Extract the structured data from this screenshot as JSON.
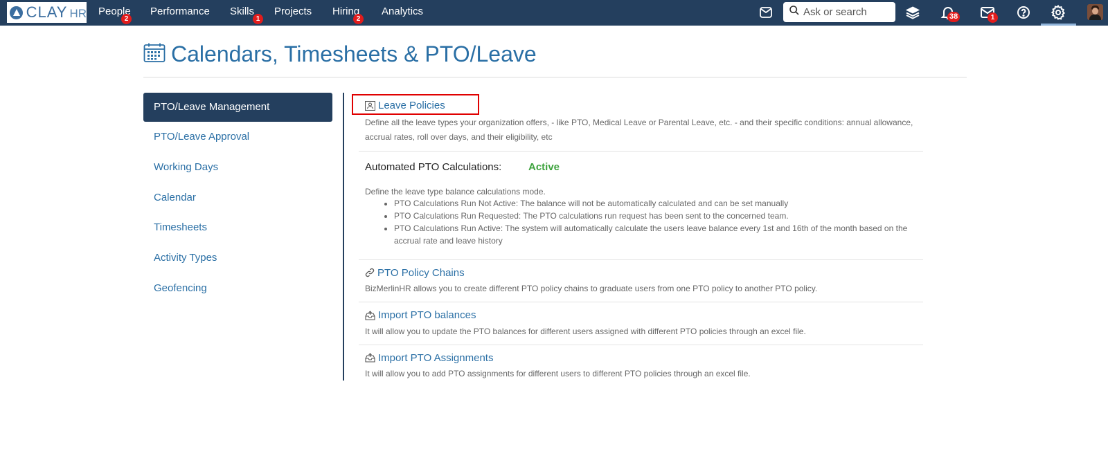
{
  "brand": {
    "logo_text": "CLAY",
    "logo_suffix": "HR"
  },
  "nav": {
    "items": [
      {
        "label": "People",
        "badge": "2"
      },
      {
        "label": "Performance",
        "badge": ""
      },
      {
        "label": "Skills",
        "badge": "1"
      },
      {
        "label": "Projects",
        "badge": ""
      },
      {
        "label": "Hiring",
        "badge": "2"
      },
      {
        "label": "Analytics",
        "badge": ""
      }
    ],
    "search_placeholder": "Ask or search",
    "notifications_badge": "38",
    "messages_badge": "1"
  },
  "page": {
    "title": "Calendars, Timesheets & PTO/Leave"
  },
  "sidebar": {
    "items": [
      {
        "label": "PTO/Leave Management",
        "active": true
      },
      {
        "label": "PTO/Leave Approval",
        "active": false
      },
      {
        "label": "Working Days",
        "active": false
      },
      {
        "label": "Calendar",
        "active": false
      },
      {
        "label": "Timesheets",
        "active": false
      },
      {
        "label": "Activity Types",
        "active": false
      },
      {
        "label": "Geofencing",
        "active": false
      }
    ]
  },
  "content": {
    "leave_policies": {
      "title": "Leave Policies",
      "desc": "Define all the leave types your organization offers, - like PTO, Medical Leave or Parental Leave, etc. - and their specific conditions: annual allowance, accrual rates, roll over days, and their eligibility, etc"
    },
    "automated_pto": {
      "label": "Automated PTO Calculations:",
      "status": "Active",
      "intro": "Define the leave type balance calculations mode.",
      "bullets": [
        "PTO Calculations Run Not Active: The balance will not be automatically calculated and can be set manually",
        "PTO Calculations Run Requested: The PTO calculations run request has been sent to the concerned team.",
        "PTO Calculations Run Active: The system will automatically calculate the users leave balance every 1st and 16th of the month based on the accrual rate and leave history"
      ]
    },
    "policy_chains": {
      "title": "PTO Policy Chains",
      "desc": "BizMerlinHR allows you to create different PTO policy chains to graduate users from one PTO policy to another PTO policy."
    },
    "import_balances": {
      "title": "Import PTO balances",
      "desc": "It will allow you to update the PTO balances for different users assigned with different PTO policies through an excel file."
    },
    "import_assignments": {
      "title": "Import PTO Assignments",
      "desc": "It will allow you to add PTO assignments for different users to different PTO policies through an excel file."
    }
  },
  "colors": {
    "navbar": "#243f5e",
    "link": "#2a6fa5",
    "active_status": "#3ea33e",
    "badge": "#e21c1c",
    "highlight": "#e00000"
  }
}
